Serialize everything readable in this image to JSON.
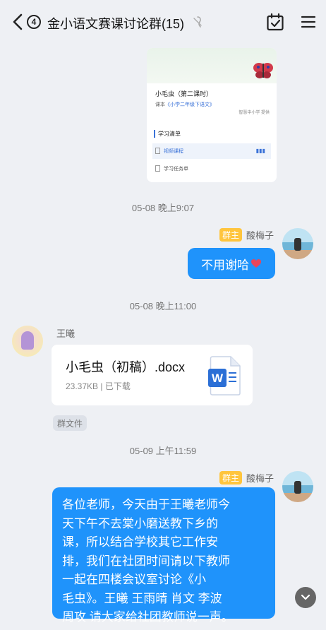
{
  "header": {
    "unread_count": "4",
    "title": "金小语文赛课讨论群(15)"
  },
  "shared_card": {
    "lesson_title": "小毛虫（第二课时）",
    "text_prefix": "课本",
    "textbook": "《小学二年级下语文》",
    "tag": "智慧中小学 提供",
    "list_title": "学习清单",
    "rows": [
      "视频课程",
      "学习任务单"
    ]
  },
  "messages": {
    "time1": "05-08 晚上9:07",
    "msg1": {
      "badge": "群主",
      "sender": "酸梅子",
      "text": "不用谢哈"
    },
    "time2": "05-08 晚上11:00",
    "msg2": {
      "sender": "王曦",
      "file_name": "小毛虫（初稿）.docx",
      "file_meta": "23.37KB | 已下载",
      "tag": "群文件"
    },
    "time3": "05-09 上午11:59",
    "msg3": {
      "badge": "群主",
      "sender": "酸梅子",
      "lines": [
        "各位老师，今天由于王曦老师今",
        "天下午不去棠小磨送教下乡的",
        "课，所以结合学校其它工作安",
        "排，我们在社团时间请以下教师",
        "一起在四楼会议室讨论《小",
        "毛虫》。王曦 王雨晴 肖文 李波",
        "周攻 请大家给社团教师说一声。"
      ]
    }
  },
  "colors": {
    "bubble": "#1f93fb",
    "badge": "#ffc53d",
    "background": "#eef0f4"
  },
  "icons": [
    "back-icon",
    "silent-icon",
    "calendar-check-icon",
    "menu-icon",
    "word-file-icon",
    "heart-icon",
    "chevron-down-icon"
  ]
}
